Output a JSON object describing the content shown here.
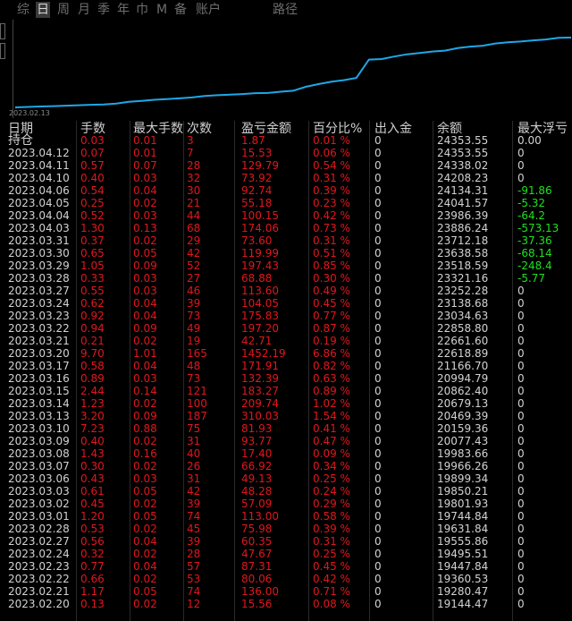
{
  "tabs": [
    "综",
    "日",
    "周",
    "月",
    "季",
    "年",
    "巾",
    "M",
    "备",
    "账户",
    "路径"
  ],
  "active_tab": "日",
  "chart": {
    "start_date": "2023.02.13",
    "line_color": "#1fa7e8"
  },
  "columns": [
    "日期",
    "手数",
    "最大手数",
    "次数",
    "盈亏金额",
    "百分比%",
    "出入金",
    "余额",
    "最大浮亏"
  ],
  "holding_label": "持仓",
  "rows": [
    {
      "date": "持仓",
      "lots": "0.03",
      "maxlots": "0.01",
      "count": "3",
      "pnl": "1.87",
      "pct": "0.01 %",
      "io": "0",
      "balance": "24353.55",
      "maxdd": "0.00"
    },
    {
      "date": "2023.04.12",
      "lots": "0.07",
      "maxlots": "0.01",
      "count": "7",
      "pnl": "15.53",
      "pct": "0.06 %",
      "io": "0",
      "balance": "24353.55",
      "maxdd": "0"
    },
    {
      "date": "2023.04.11",
      "lots": "0.57",
      "maxlots": "0.07",
      "count": "28",
      "pnl": "129.79",
      "pct": "0.54 %",
      "io": "0",
      "balance": "24338.02",
      "maxdd": "0"
    },
    {
      "date": "2023.04.10",
      "lots": "0.40",
      "maxlots": "0.03",
      "count": "32",
      "pnl": "73.92",
      "pct": "0.31 %",
      "io": "0",
      "balance": "24208.23",
      "maxdd": "0"
    },
    {
      "date": "2023.04.06",
      "lots": "0.54",
      "maxlots": "0.04",
      "count": "30",
      "pnl": "92.74",
      "pct": "0.39 %",
      "io": "0",
      "balance": "24134.31",
      "maxdd": "-91.86"
    },
    {
      "date": "2023.04.05",
      "lots": "0.25",
      "maxlots": "0.02",
      "count": "21",
      "pnl": "55.18",
      "pct": "0.23 %",
      "io": "0",
      "balance": "24041.57",
      "maxdd": "-5.32"
    },
    {
      "date": "2023.04.04",
      "lots": "0.52",
      "maxlots": "0.03",
      "count": "44",
      "pnl": "100.15",
      "pct": "0.42 %",
      "io": "0",
      "balance": "23986.39",
      "maxdd": "-64.2"
    },
    {
      "date": "2023.04.03",
      "lots": "1.30",
      "maxlots": "0.13",
      "count": "68",
      "pnl": "174.06",
      "pct": "0.73 %",
      "io": "0",
      "balance": "23886.24",
      "maxdd": "-573.13"
    },
    {
      "date": "2023.03.31",
      "lots": "0.37",
      "maxlots": "0.02",
      "count": "29",
      "pnl": "73.60",
      "pct": "0.31 %",
      "io": "0",
      "balance": "23712.18",
      "maxdd": "-37.36"
    },
    {
      "date": "2023.03.30",
      "lots": "0.65",
      "maxlots": "0.05",
      "count": "42",
      "pnl": "119.99",
      "pct": "0.51 %",
      "io": "0",
      "balance": "23638.58",
      "maxdd": "-68.14"
    },
    {
      "date": "2023.03.29",
      "lots": "1.05",
      "maxlots": "0.09",
      "count": "52",
      "pnl": "197.43",
      "pct": "0.85 %",
      "io": "0",
      "balance": "23518.59",
      "maxdd": "-248.4"
    },
    {
      "date": "2023.03.28",
      "lots": "0.33",
      "maxlots": "0.03",
      "count": "27",
      "pnl": "68.88",
      "pct": "0.30 %",
      "io": "0",
      "balance": "23321.16",
      "maxdd": "-5.77"
    },
    {
      "date": "2023.03.27",
      "lots": "0.55",
      "maxlots": "0.03",
      "count": "46",
      "pnl": "113.60",
      "pct": "0.49 %",
      "io": "0",
      "balance": "23252.28",
      "maxdd": "0"
    },
    {
      "date": "2023.03.24",
      "lots": "0.62",
      "maxlots": "0.04",
      "count": "39",
      "pnl": "104.05",
      "pct": "0.45 %",
      "io": "0",
      "balance": "23138.68",
      "maxdd": "0"
    },
    {
      "date": "2023.03.23",
      "lots": "0.92",
      "maxlots": "0.04",
      "count": "73",
      "pnl": "175.83",
      "pct": "0.77 %",
      "io": "0",
      "balance": "23034.63",
      "maxdd": "0"
    },
    {
      "date": "2023.03.22",
      "lots": "0.94",
      "maxlots": "0.09",
      "count": "49",
      "pnl": "197.20",
      "pct": "0.87 %",
      "io": "0",
      "balance": "22858.80",
      "maxdd": "0"
    },
    {
      "date": "2023.03.21",
      "lots": "0.21",
      "maxlots": "0.02",
      "count": "19",
      "pnl": "42.71",
      "pct": "0.19 %",
      "io": "0",
      "balance": "22661.60",
      "maxdd": "0"
    },
    {
      "date": "2023.03.20",
      "lots": "9.70",
      "maxlots": "1.01",
      "count": "165",
      "pnl": "1452.19",
      "pct": "6.86 %",
      "io": "0",
      "balance": "22618.89",
      "maxdd": "0"
    },
    {
      "date": "2023.03.17",
      "lots": "0.58",
      "maxlots": "0.04",
      "count": "48",
      "pnl": "171.91",
      "pct": "0.82 %",
      "io": "0",
      "balance": "21166.70",
      "maxdd": "0"
    },
    {
      "date": "2023.03.16",
      "lots": "0.89",
      "maxlots": "0.03",
      "count": "73",
      "pnl": "132.39",
      "pct": "0.63 %",
      "io": "0",
      "balance": "20994.79",
      "maxdd": "0"
    },
    {
      "date": "2023.03.15",
      "lots": "2.44",
      "maxlots": "0.14",
      "count": "121",
      "pnl": "183.27",
      "pct": "0.89 %",
      "io": "0",
      "balance": "20862.40",
      "maxdd": "0"
    },
    {
      "date": "2023.03.14",
      "lots": "1.23",
      "maxlots": "0.02",
      "count": "100",
      "pnl": "209.74",
      "pct": "1.02 %",
      "io": "0",
      "balance": "20679.13",
      "maxdd": "0"
    },
    {
      "date": "2023.03.13",
      "lots": "3.20",
      "maxlots": "0.09",
      "count": "187",
      "pnl": "310.03",
      "pct": "1.54 %",
      "io": "0",
      "balance": "20469.39",
      "maxdd": "0"
    },
    {
      "date": "2023.03.10",
      "lots": "7.23",
      "maxlots": "0.88",
      "count": "75",
      "pnl": "81.93",
      "pct": "0.41 %",
      "io": "0",
      "balance": "20159.36",
      "maxdd": "0"
    },
    {
      "date": "2023.03.09",
      "lots": "0.40",
      "maxlots": "0.02",
      "count": "31",
      "pnl": "93.77",
      "pct": "0.47 %",
      "io": "0",
      "balance": "20077.43",
      "maxdd": "0"
    },
    {
      "date": "2023.03.08",
      "lots": "1.43",
      "maxlots": "0.16",
      "count": "40",
      "pnl": "17.40",
      "pct": "0.09 %",
      "io": "0",
      "balance": "19983.66",
      "maxdd": "0"
    },
    {
      "date": "2023.03.07",
      "lots": "0.30",
      "maxlots": "0.02",
      "count": "26",
      "pnl": "66.92",
      "pct": "0.34 %",
      "io": "0",
      "balance": "19966.26",
      "maxdd": "0"
    },
    {
      "date": "2023.03.06",
      "lots": "0.43",
      "maxlots": "0.03",
      "count": "31",
      "pnl": "49.13",
      "pct": "0.25 %",
      "io": "0",
      "balance": "19899.34",
      "maxdd": "0"
    },
    {
      "date": "2023.03.03",
      "lots": "0.61",
      "maxlots": "0.05",
      "count": "42",
      "pnl": "48.28",
      "pct": "0.24 %",
      "io": "0",
      "balance": "19850.21",
      "maxdd": "0"
    },
    {
      "date": "2023.03.02",
      "lots": "0.45",
      "maxlots": "0.02",
      "count": "39",
      "pnl": "57.09",
      "pct": "0.29 %",
      "io": "0",
      "balance": "19801.93",
      "maxdd": "0"
    },
    {
      "date": "2023.03.01",
      "lots": "1.20",
      "maxlots": "0.05",
      "count": "74",
      "pnl": "113.00",
      "pct": "0.58 %",
      "io": "0",
      "balance": "19744.84",
      "maxdd": "0"
    },
    {
      "date": "2023.02.28",
      "lots": "0.53",
      "maxlots": "0.02",
      "count": "45",
      "pnl": "75.98",
      "pct": "0.39 %",
      "io": "0",
      "balance": "19631.84",
      "maxdd": "0"
    },
    {
      "date": "2023.02.27",
      "lots": "0.56",
      "maxlots": "0.04",
      "count": "39",
      "pnl": "60.35",
      "pct": "0.31 %",
      "io": "0",
      "balance": "19555.86",
      "maxdd": "0"
    },
    {
      "date": "2023.02.24",
      "lots": "0.32",
      "maxlots": "0.02",
      "count": "28",
      "pnl": "47.67",
      "pct": "0.25 %",
      "io": "0",
      "balance": "19495.51",
      "maxdd": "0"
    },
    {
      "date": "2023.02.23",
      "lots": "0.77",
      "maxlots": "0.04",
      "count": "57",
      "pnl": "87.31",
      "pct": "0.45 %",
      "io": "0",
      "balance": "19447.84",
      "maxdd": "0"
    },
    {
      "date": "2023.02.22",
      "lots": "0.66",
      "maxlots": "0.02",
      "count": "53",
      "pnl": "80.06",
      "pct": "0.42 %",
      "io": "0",
      "balance": "19360.53",
      "maxdd": "0"
    },
    {
      "date": "2023.02.21",
      "lots": "1.17",
      "maxlots": "0.05",
      "count": "74",
      "pnl": "136.00",
      "pct": "0.71 %",
      "io": "0",
      "balance": "19280.47",
      "maxdd": "0"
    },
    {
      "date": "2023.02.20",
      "lots": "0.13",
      "maxlots": "0.02",
      "count": "12",
      "pnl": "15.56",
      "pct": "0.08 %",
      "io": "0",
      "balance": "19144.47",
      "maxdd": "0"
    }
  ]
}
